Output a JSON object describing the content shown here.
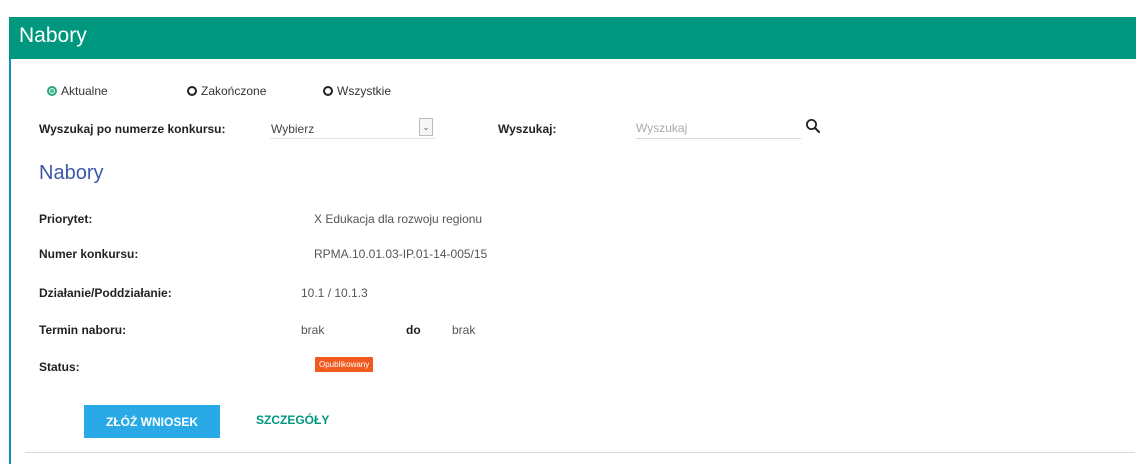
{
  "header": {
    "title": "Nabory"
  },
  "filters": {
    "options": [
      {
        "label": "Aktualne",
        "checked": true
      },
      {
        "label": "Zakończone",
        "checked": false
      },
      {
        "label": "Wszystkie",
        "checked": false
      }
    ]
  },
  "search": {
    "number_label": "Wyszukaj po numerze konkursu:",
    "number_select_value": "Wybierz",
    "text_label": "Wyszukaj:",
    "text_placeholder": "Wyszukaj",
    "search_icon": "search-icon"
  },
  "section": {
    "title": "Nabory"
  },
  "details": {
    "priorytet_label": "Priorytet:",
    "priorytet_value": "X Edukacja dla rozwoju regionu",
    "numer_label": "Numer konkursu:",
    "numer_value": "RPMA.10.01.03-IP.01-14-005/15",
    "dzialanie_label": "Działanie/Poddziałanie:",
    "dzialanie_value": "10.1 / 10.1.3",
    "termin_label": "Termin naboru:",
    "termin_from": "brak",
    "termin_sep": "do",
    "termin_to": "brak",
    "status_label": "Status:",
    "status_value": "Opublikowany"
  },
  "actions": {
    "submit_label": "ZŁÓŻ WNIOSEK",
    "details_label": "SZCZEGÓŁY"
  },
  "colors": {
    "header": "#00977f",
    "accent_blue": "#29a9e6",
    "status_badge": "#f05a1f",
    "section_title": "#3a59a6"
  }
}
